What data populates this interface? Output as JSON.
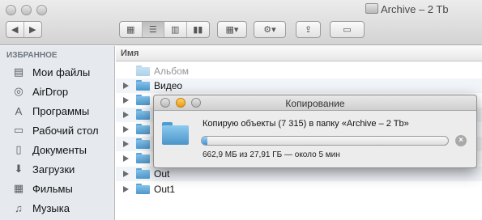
{
  "window": {
    "title": "Archive – 2 Tb"
  },
  "toolbar": {
    "back_icon": "chevron-left-icon",
    "forward_icon": "chevron-right-icon",
    "view_modes": [
      "icon-view",
      "list-view",
      "column-view",
      "cover-flow-view"
    ],
    "active_view": "list-view"
  },
  "sidebar": {
    "heading": "ИЗБРАННОЕ",
    "items": [
      {
        "label": "Мои файлы",
        "icon": "documents-stack-icon"
      },
      {
        "label": "AirDrop",
        "icon": "airdrop-icon"
      },
      {
        "label": "Программы",
        "icon": "applications-icon"
      },
      {
        "label": "Рабочий стол",
        "icon": "desktop-icon"
      },
      {
        "label": "Документы",
        "icon": "document-icon"
      },
      {
        "label": "Загрузки",
        "icon": "download-icon"
      },
      {
        "label": "Фильмы",
        "icon": "film-icon"
      },
      {
        "label": "Музыка",
        "icon": "music-icon"
      }
    ]
  },
  "list": {
    "column_header": "Имя",
    "rows": [
      {
        "name": "Альбом",
        "faded": true
      },
      {
        "name": "Видео",
        "faded": false
      },
      {
        "name": "",
        "faded": false
      },
      {
        "name": "",
        "faded": false
      },
      {
        "name": "",
        "faded": false
      },
      {
        "name": "",
        "faded": false
      },
      {
        "name": "",
        "faded": false
      },
      {
        "name": "Out",
        "faded": false
      },
      {
        "name": "Out1",
        "faded": false
      }
    ]
  },
  "copy_dialog": {
    "title": "Копирование",
    "message": "Копирую объекты (7 315) в папку «Archive – 2 Tb»",
    "progress_fraction": 0.024,
    "status": "662,9 МБ из 27,91 ГБ — около 5 мин",
    "cancel_icon": "cancel-x-icon"
  },
  "colors": {
    "folder_blue": "#5aa3d8",
    "sidebar_bg": "#e6eaef",
    "progress_fill": "#3f8fd2"
  }
}
